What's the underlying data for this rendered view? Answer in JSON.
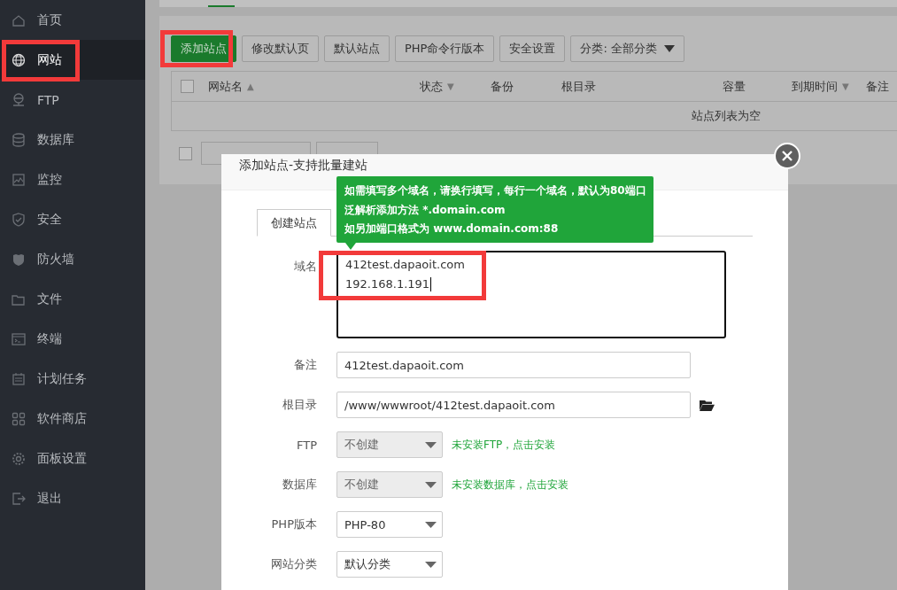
{
  "sidebar": {
    "items": [
      {
        "label": "首页",
        "selected": false,
        "highlighted": false
      },
      {
        "label": "网站",
        "selected": true,
        "highlighted": true
      },
      {
        "label": "FTP",
        "selected": false,
        "highlighted": false
      },
      {
        "label": "数据库",
        "selected": false,
        "highlighted": false
      },
      {
        "label": "监控",
        "selected": false,
        "highlighted": false
      },
      {
        "label": "安全",
        "selected": false,
        "highlighted": false
      },
      {
        "label": "防火墙",
        "selected": false,
        "highlighted": false
      },
      {
        "label": "文件",
        "selected": false,
        "highlighted": false
      },
      {
        "label": "终端",
        "selected": false,
        "highlighted": false
      },
      {
        "label": "计划任务",
        "selected": false,
        "highlighted": false
      },
      {
        "label": "软件商店",
        "selected": false,
        "highlighted": false
      },
      {
        "label": "面板设置",
        "selected": false,
        "highlighted": false
      },
      {
        "label": "退出",
        "selected": false,
        "highlighted": false
      }
    ]
  },
  "toolbar": {
    "buttons": [
      {
        "label": "添加站点",
        "kind": "primary",
        "highlighted": true
      },
      {
        "label": "修改默认页",
        "kind": "plain",
        "highlighted": false
      },
      {
        "label": "默认站点",
        "kind": "plain",
        "highlighted": false
      },
      {
        "label": "PHP命令行版本",
        "kind": "plain",
        "highlighted": false
      },
      {
        "label": "安全设置",
        "kind": "plain",
        "highlighted": false
      },
      {
        "label": "分类: 全部分类",
        "kind": "dropdown",
        "highlighted": false
      }
    ]
  },
  "table": {
    "select_all": {
      "checked": false
    },
    "columns": [
      {
        "label": "网站名",
        "sort_arrow": "▲"
      },
      {
        "label": "状态",
        "sort_arrow": "▼"
      },
      {
        "label": "备份"
      },
      {
        "label": "根目录"
      },
      {
        "label": "容量"
      },
      {
        "label": "到期时间",
        "sort_arrow": "▼"
      },
      {
        "label": "备注"
      }
    ],
    "empty_text": "站点列表为空"
  },
  "batch": {
    "checked": false
  },
  "dialog": {
    "title": "添加站点-支持批量建站",
    "tabs": [
      {
        "label": "创建站点",
        "selected": true
      }
    ],
    "tooltip": [
      "如需填写多个域名，请换行填写，每行一个域名，默认为80端口",
      "泛解析添加方法 *.domain.com",
      "如另加端口格式为 www.domain.com:88"
    ],
    "fields": [
      {
        "kind": "textarea",
        "label": "域名",
        "lines": [
          "412test.dapaoit.com",
          "192.168.1.191"
        ],
        "highlighted": true
      },
      {
        "kind": "input",
        "label": "备注",
        "value": "412test.dapaoit.com"
      },
      {
        "kind": "folder",
        "label": "根目录",
        "value": "/www/wwwroot/412test.dapaoit.com"
      },
      {
        "kind": "select",
        "label": "FTP",
        "value": "不创建",
        "disabled": true,
        "hint": "未安装FTP，点击安装"
      },
      {
        "kind": "select",
        "label": "数据库",
        "value": "不创建",
        "disabled": true,
        "hint": "未安装数据库，点击安装"
      },
      {
        "kind": "select",
        "label": "PHP版本",
        "value": "PHP-80",
        "disabled": false
      },
      {
        "kind": "select",
        "label": "网站分类",
        "value": "默认分类",
        "disabled": false
      }
    ]
  }
}
